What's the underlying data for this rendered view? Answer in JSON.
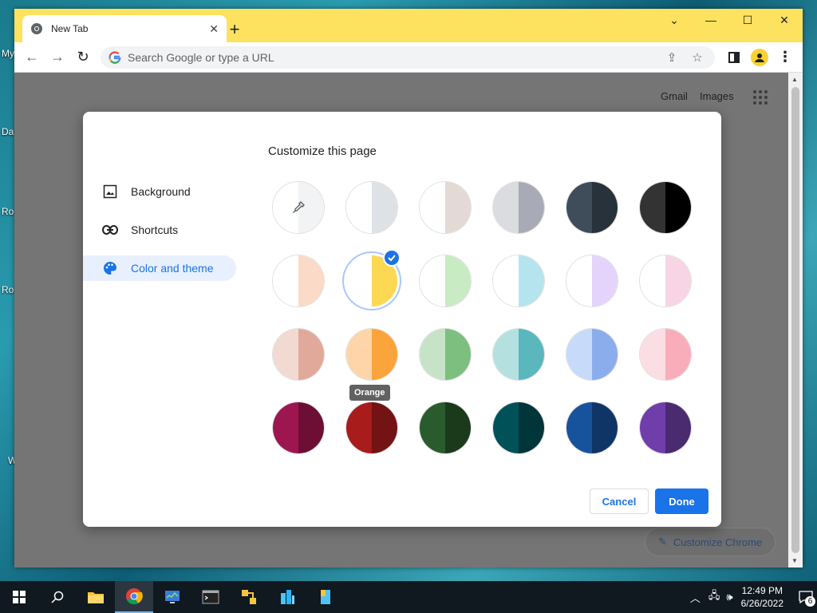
{
  "desktop": {
    "labels": [
      "My",
      "Da",
      "Ro",
      "Ro",
      "W"
    ]
  },
  "browser": {
    "tab_title": "New Tab",
    "omnibox_placeholder": "Search Google or type a URL",
    "links": {
      "gmail": "Gmail",
      "images": "Images"
    },
    "customize_chrome_label": "Customize Chrome"
  },
  "dialog": {
    "title": "Customize this page",
    "sidebar": [
      {
        "label": "Background",
        "icon": "image-icon",
        "active": false
      },
      {
        "label": "Shortcuts",
        "icon": "link-icon",
        "active": false
      },
      {
        "label": "Color and theme",
        "icon": "palette-icon",
        "active": true
      }
    ],
    "swatches": [
      [
        {
          "name": "custom-color",
          "left": "#ffffff",
          "right": "#f1f3f4",
          "picker": true
        },
        {
          "name": "default-white",
          "left": "#ffffff",
          "right": "#dee1e6"
        },
        {
          "name": "warm-grey",
          "left": "#ffffff",
          "right": "#e3dad6"
        },
        {
          "name": "cool-grey",
          "left": "#dadce0",
          "right": "#a8abb5"
        },
        {
          "name": "midnight-blue",
          "left": "#3e4d59",
          "right": "#27323a"
        },
        {
          "name": "black",
          "left": "#333333",
          "right": "#000000"
        }
      ],
      [
        {
          "name": "beige-white",
          "left": "#ffffff",
          "right": "#fbdbc7"
        },
        {
          "name": "yellow-white",
          "left": "#ffffff",
          "right": "#fdd853",
          "selected": true
        },
        {
          "name": "green-white",
          "left": "#ffffff",
          "right": "#c9ebc4"
        },
        {
          "name": "light-teal-white",
          "left": "#ffffff",
          "right": "#b5e4ee"
        },
        {
          "name": "light-purple-white",
          "left": "#ffffff",
          "right": "#e4d4fb"
        },
        {
          "name": "pink-white",
          "left": "#ffffff",
          "right": "#f8d5e4"
        }
      ],
      [
        {
          "name": "beige",
          "left": "#f2d9d1",
          "right": "#e0a999"
        },
        {
          "name": "orange",
          "left": "#fdd5a8",
          "right": "#fba43c",
          "tooltip": "Orange"
        },
        {
          "name": "light-green",
          "left": "#c6e3c7",
          "right": "#7cbf7e"
        },
        {
          "name": "light-teal",
          "left": "#b5e0e0",
          "right": "#5ab7be"
        },
        {
          "name": "light-blue",
          "left": "#c7daf9",
          "right": "#8cadeb"
        },
        {
          "name": "light-pink",
          "left": "#fbdde4",
          "right": "#f9adbb"
        }
      ],
      [
        {
          "name": "dark-pink-red",
          "left": "#9e1650",
          "right": "#6d0f35"
        },
        {
          "name": "dark-red-orange",
          "left": "#a81c1c",
          "right": "#741313"
        },
        {
          "name": "dark-green",
          "left": "#2a5b2c",
          "right": "#1b3a1c"
        },
        {
          "name": "dark-teal",
          "left": "#005158",
          "right": "#003539"
        },
        {
          "name": "dark-blue",
          "left": "#17539d",
          "right": "#0e3566"
        },
        {
          "name": "purple",
          "left": "#6f3eab",
          "right": "#4a2b6f"
        }
      ]
    ],
    "cancel_label": "Cancel",
    "done_label": "Done"
  },
  "taskbar": {
    "time": "12:49 PM",
    "date": "6/26/2022",
    "notification_count": "6"
  }
}
